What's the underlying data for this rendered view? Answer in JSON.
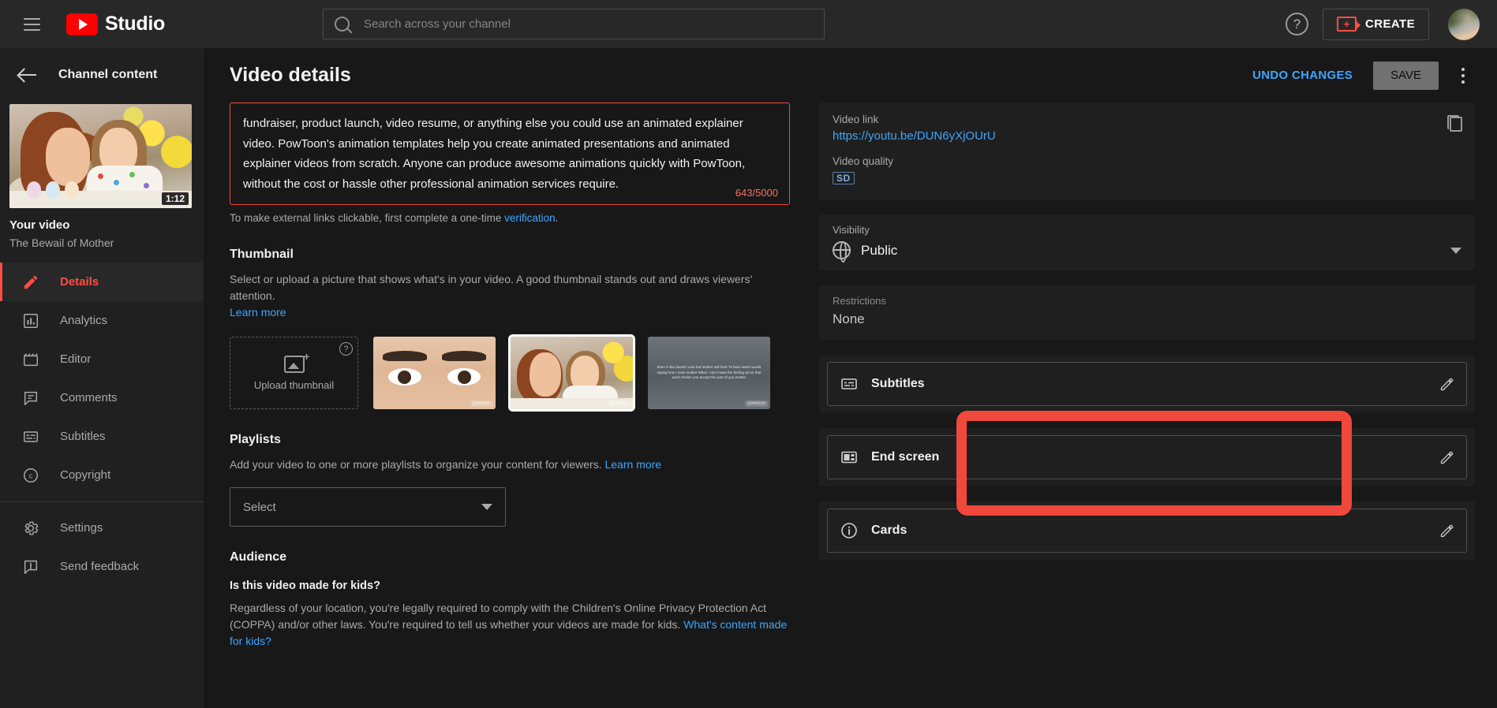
{
  "topbar": {
    "menu_icon": "hamburger-icon",
    "brand": "Studio",
    "search_placeholder": "Search across your channel",
    "search_value": "",
    "help_glyph": "?",
    "create_label": "CREATE"
  },
  "sidebar": {
    "header_title": "Channel content",
    "video": {
      "duration": "1:12",
      "label": "Your video",
      "title": "The Bewail of Mother"
    },
    "items": [
      {
        "label": "Details",
        "icon": "pencil-icon",
        "active": true
      },
      {
        "label": "Analytics",
        "icon": "bar-chart-icon",
        "active": false
      },
      {
        "label": "Editor",
        "icon": "clapperboard-icon",
        "active": false
      },
      {
        "label": "Comments",
        "icon": "comment-icon",
        "active": false
      },
      {
        "label": "Subtitles",
        "icon": "subtitles-icon",
        "active": false
      },
      {
        "label": "Copyright",
        "icon": "copyright-icon",
        "active": false
      }
    ],
    "footer_items": [
      {
        "label": "Settings",
        "icon": "gear-icon"
      },
      {
        "label": "Send feedback",
        "icon": "feedback-icon"
      }
    ]
  },
  "main": {
    "page_title": "Video details",
    "undo_label": "UNDO CHANGES",
    "save_label": "SAVE",
    "description": {
      "text": "fundraiser, product launch, video resume, or anything else you could use an animated explainer video. PowToon's animation templates help you create animated presentations and animated explainer videos from scratch.  Anyone can produce awesome animations quickly with PowToon, without the cost or hassle other professional animation services require.",
      "char_count": "643/5000",
      "hint_prefix": "To make external links clickable, first complete a one-time ",
      "hint_link": "verification",
      "hint_suffix": "."
    },
    "thumbnail": {
      "title": "Thumbnail",
      "description": "Select or upload a picture that shows what's in your video. A good thumbnail stands out and draws viewers' attention.",
      "learn_more": "Learn more",
      "upload_label": "Upload thumbnail",
      "help_glyph": "?",
      "watermark": "powtoon",
      "option3_text": "Even if she doesn't care but mother still here To hear sweet words saying how I miss mother When I don't want the feeling Since that word chosen you accept the part of you mother"
    },
    "playlists": {
      "title": "Playlists",
      "description": "Add your video to one or more playlists to organize your content for viewers. ",
      "learn_more": "Learn more",
      "select_value": "Select"
    },
    "audience": {
      "title": "Audience",
      "question": "Is this video made for kids?",
      "paragraph": "Regardless of your location, you're legally required to comply with the Children's Online Privacy Protection Act (COPPA) and/or other laws. You're required to tell us whether your videos are made for kids. ",
      "link": "What's content made for kids?"
    }
  },
  "right_panel": {
    "video_link": {
      "label": "Video link",
      "url": "https://youtu.be/DUN6yXjOUrU",
      "copy_icon": "copy-icon"
    },
    "video_quality": {
      "label": "Video quality",
      "badge": "SD"
    },
    "visibility": {
      "label": "Visibility",
      "value": "Public",
      "icon": "globe-icon"
    },
    "restrictions": {
      "label": "Restrictions",
      "value": "None"
    },
    "features": [
      {
        "label": "Subtitles",
        "icon": "subtitles-icon",
        "edit_icon": "pencil-icon",
        "highlighted": true
      },
      {
        "label": "End screen",
        "icon": "end-screen-icon",
        "edit_icon": "pencil-icon",
        "highlighted": false
      },
      {
        "label": "Cards",
        "icon": "info-circle-icon",
        "edit_icon": "pencil-icon",
        "highlighted": false
      }
    ]
  },
  "colors": {
    "accent_red": "#f1483c",
    "link_blue": "#3ea6ff",
    "bg": "#181818",
    "panel": "#1f1f1f",
    "sidebar": "#202020"
  }
}
